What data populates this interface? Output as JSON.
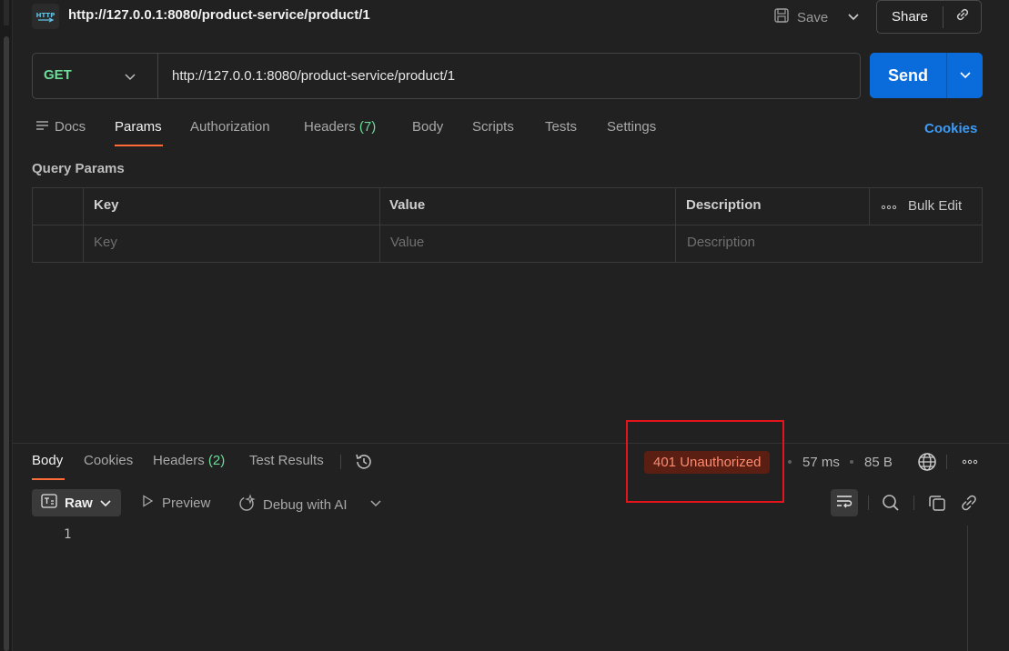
{
  "header": {
    "icon_text": "HTTP",
    "title": "http://127.0.0.1:8080/product-service/product/1",
    "save_label": "Save",
    "share_label": "Share"
  },
  "request": {
    "method": "GET",
    "url": "http://127.0.0.1:8080/product-service/product/1",
    "send_label": "Send"
  },
  "request_tabs": {
    "docs": "Docs",
    "params": "Params",
    "authorization": "Authorization",
    "headers": "Headers",
    "headers_count": "(7)",
    "body": "Body",
    "scripts": "Scripts",
    "tests": "Tests",
    "settings": "Settings",
    "active": "Params"
  },
  "cookies_link": "Cookies",
  "query_params": {
    "title": "Query Params",
    "columns": {
      "key": "Key",
      "value": "Value",
      "description": "Description"
    },
    "bulk_edit": "Bulk Edit",
    "placeholders": {
      "key": "Key",
      "value": "Value",
      "description": "Description"
    }
  },
  "response_tabs": {
    "body": "Body",
    "cookies": "Cookies",
    "headers": "Headers",
    "headers_count": "(2)",
    "test_results": "Test Results",
    "active": "Body"
  },
  "response_meta": {
    "status": "401 Unauthorized",
    "time": "57 ms",
    "size": "85 B",
    "status_color": "#ff8a70",
    "highlight_color": "#e3141b"
  },
  "response_toolbar": {
    "format": "Raw",
    "preview": "Preview",
    "debug": "Debug with AI"
  },
  "editor": {
    "line_numbers": [
      "1"
    ]
  },
  "colors": {
    "accent_orange": "#ff6c37",
    "send_blue": "#0a6bdb",
    "method_green": "#6bdd9a",
    "link_blue": "#3d9bf5"
  }
}
